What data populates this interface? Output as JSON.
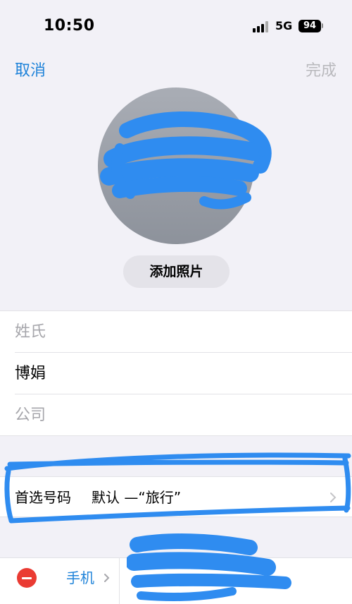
{
  "status_bar": {
    "time": "10:50",
    "network": "5G",
    "battery": "94"
  },
  "nav": {
    "cancel_label": "取消",
    "done_label": "完成"
  },
  "avatar": {
    "add_photo_label": "添加照片"
  },
  "fields": {
    "last_name_placeholder": "姓氏",
    "first_name_value": "博娟",
    "company_placeholder": "公司"
  },
  "preferred": {
    "label": "首选号码",
    "value": "默认 —“旅行”"
  },
  "phone": {
    "label": "手机"
  },
  "colors": {
    "accent": "#1f83d9",
    "delete": "#ea3b33",
    "background": "#f2f1f7",
    "scribble": "#2f8cf0"
  }
}
